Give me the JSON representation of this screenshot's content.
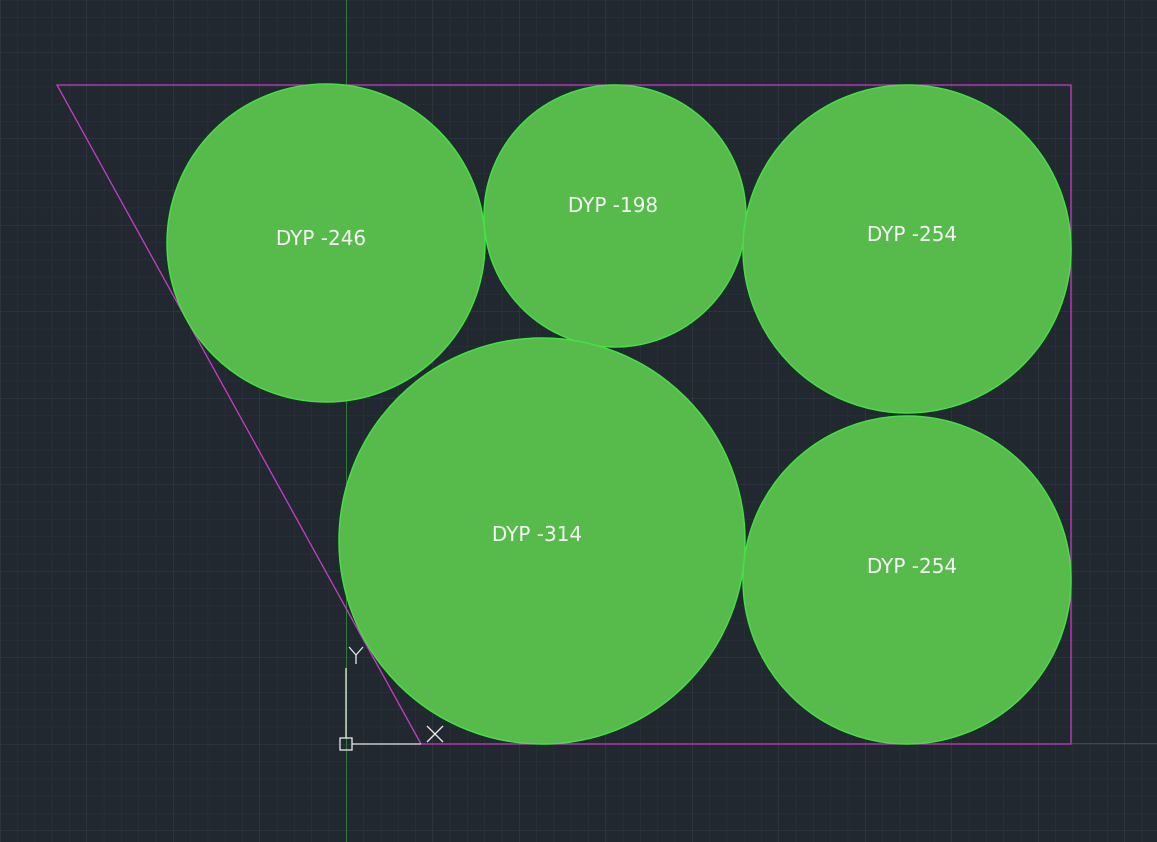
{
  "colors": {
    "background": "#212830",
    "grid_minor": "#2a333c",
    "grid_major": "#35404b",
    "axis_y": "#2f7a3a",
    "axis_x": "#7a2f33",
    "boundary": "#c83cc8",
    "circle_fill": "#56bb4a",
    "circle_stroke": "#44e044",
    "label_text": "#f4f4f4",
    "ucs_icon": "#e8e8e8"
  },
  "drawing": {
    "circles": [
      {
        "label": "DYP -246",
        "diameter": 246
      },
      {
        "label": "DYP -198",
        "diameter": 198
      },
      {
        "label": "DYP -254",
        "diameter": 254
      },
      {
        "label": "DYP -314",
        "diameter": 314
      },
      {
        "label": "DYP -254",
        "diameter": 254
      }
    ]
  },
  "ucs": {
    "x_label": "X",
    "y_label": "Y",
    "icon": "ucs-icon"
  }
}
